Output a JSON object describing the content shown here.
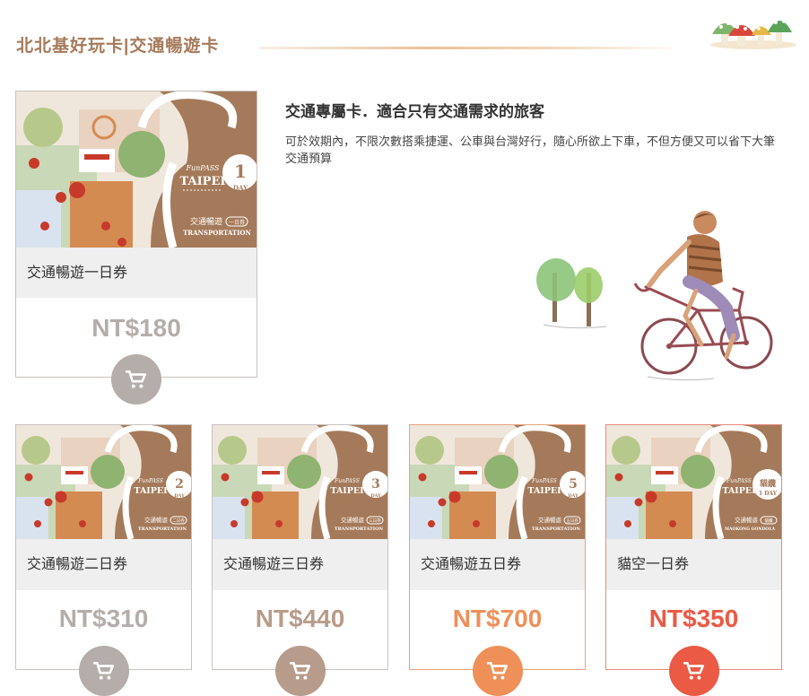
{
  "header": {
    "title": "北北基好玩卡|交通暢遊卡"
  },
  "intro": {
    "title": "交通專屬卡．適合只有交通需求的旅客",
    "description": "可於效期內，不限次數搭乘捷運、公車與台灣好行，隨心所欲上下車，不但方便又可以省下大筆交通預算"
  },
  "cards": [
    {
      "name": "交通暢遊一日券",
      "price": "NT$180",
      "badge_num": "1",
      "badge_unit": "DAY",
      "brand_small": "FunPASS",
      "brand_big": "TAIPEI",
      "caption_cn": "交通暢遊",
      "caption_tag": "一日券",
      "caption_en": "TRANSPORTATION",
      "accent": "#b4ada9"
    },
    {
      "name": "交通暢遊二日券",
      "price": "NT$310",
      "badge_num": "2",
      "badge_unit": "DAY",
      "brand_small": "FunPASS",
      "brand_big": "TAIPEI",
      "caption_cn": "交通暢遊",
      "caption_tag": "二日券",
      "caption_en": "TRANSPORTATION",
      "accent": "#b4ada9"
    },
    {
      "name": "交通暢遊三日券",
      "price": "NT$440",
      "badge_num": "3",
      "badge_unit": "DAY",
      "brand_small": "FunPASS",
      "brand_big": "TAIPEI",
      "caption_cn": "交通暢遊",
      "caption_tag": "三日券",
      "caption_en": "TRANSPORTATION",
      "accent": "#b89c8b"
    },
    {
      "name": "交通暢遊五日券",
      "price": "NT$700",
      "badge_num": "5",
      "badge_unit": "DAY",
      "brand_small": "FunPASS",
      "brand_big": "TAIPEI",
      "caption_cn": "交通暢遊",
      "caption_tag": "五日券",
      "caption_en": "TRANSPORTATION",
      "accent": "#ef9059"
    },
    {
      "name": "貓空一日券",
      "price": "NT$350",
      "badge_num": "貓纜",
      "badge_unit": "1 DAY",
      "brand_small": "FunPASS",
      "brand_big": "TAIPEI",
      "caption_cn": "交通暢遊",
      "caption_tag": "貓纜",
      "caption_en": "MAOKONG GONDOLA",
      "accent": "#ea5a45"
    }
  ]
}
